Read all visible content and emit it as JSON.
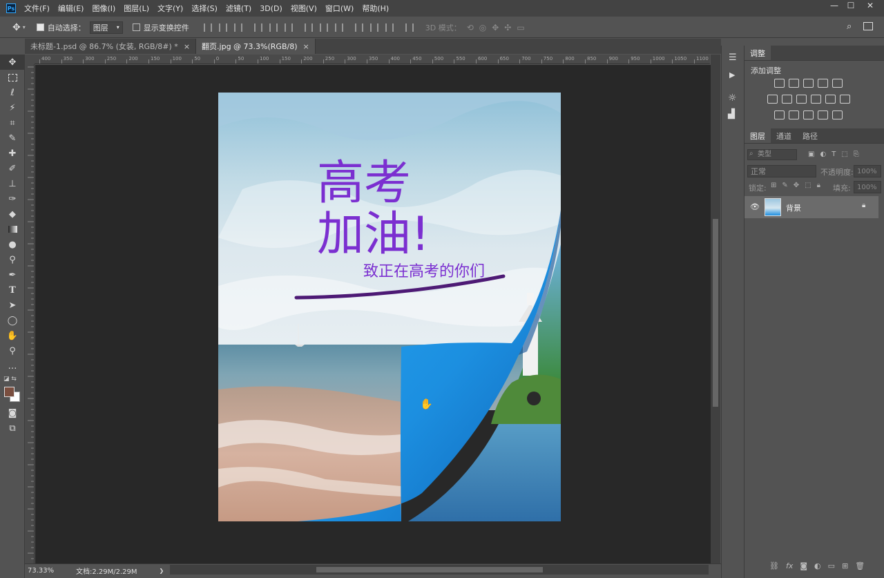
{
  "menubar": {
    "logo": "Ps",
    "items": [
      "文件(F)",
      "编辑(E)",
      "图像(I)",
      "图层(L)",
      "文字(Y)",
      "选择(S)",
      "滤镜(T)",
      "3D(D)",
      "视图(V)",
      "窗口(W)",
      "帮助(H)"
    ],
    "window_controls": [
      "—",
      "☐",
      "✕"
    ]
  },
  "options": {
    "auto_select_label": "自动选择：",
    "auto_select_value": "图层",
    "show_transform_label": "显示变换控件",
    "mode_3d_label": "3D 模式："
  },
  "tabs": [
    {
      "label": "未标题-1.psd @ 86.7% (女装, RGB/8#) *",
      "close": "×"
    },
    {
      "label": "翻页.jpg @ 73.3%(RGB/8)",
      "close": "×"
    }
  ],
  "ruler_labels": [
    "400",
    "350",
    "300",
    "250",
    "200",
    "150",
    "100",
    "50",
    "0",
    "50",
    "100",
    "150",
    "200",
    "250",
    "300",
    "350",
    "400",
    "450",
    "500",
    "550",
    "600",
    "650",
    "700",
    "750",
    "800",
    "850",
    "900",
    "950",
    "1000",
    "1050",
    "1100"
  ],
  "poster": {
    "title_line1": "高考",
    "title_line2": "加油!",
    "subtitle": "致正在高考的你们"
  },
  "status": {
    "zoom": "73.33%",
    "doc_info": "文档:2.29M/2.29M",
    "arrow": "❯"
  },
  "adjustments": {
    "tab": "调整",
    "add_label": "添加调整"
  },
  "layers_panel": {
    "tabs": [
      "图层",
      "通道",
      "路径"
    ],
    "filter_placeholder": "类型",
    "blend_mode": "正常",
    "opacity_label": "不透明度:",
    "opacity_value": "100%",
    "lock_label": "锁定:",
    "fill_label": "填充:",
    "fill_value": "100%",
    "layers": [
      {
        "name": "背景",
        "visible": true,
        "locked": true
      }
    ]
  },
  "colors": {
    "accent_purple": "#7b2fd0",
    "page_blue": "#1f8fe0"
  }
}
